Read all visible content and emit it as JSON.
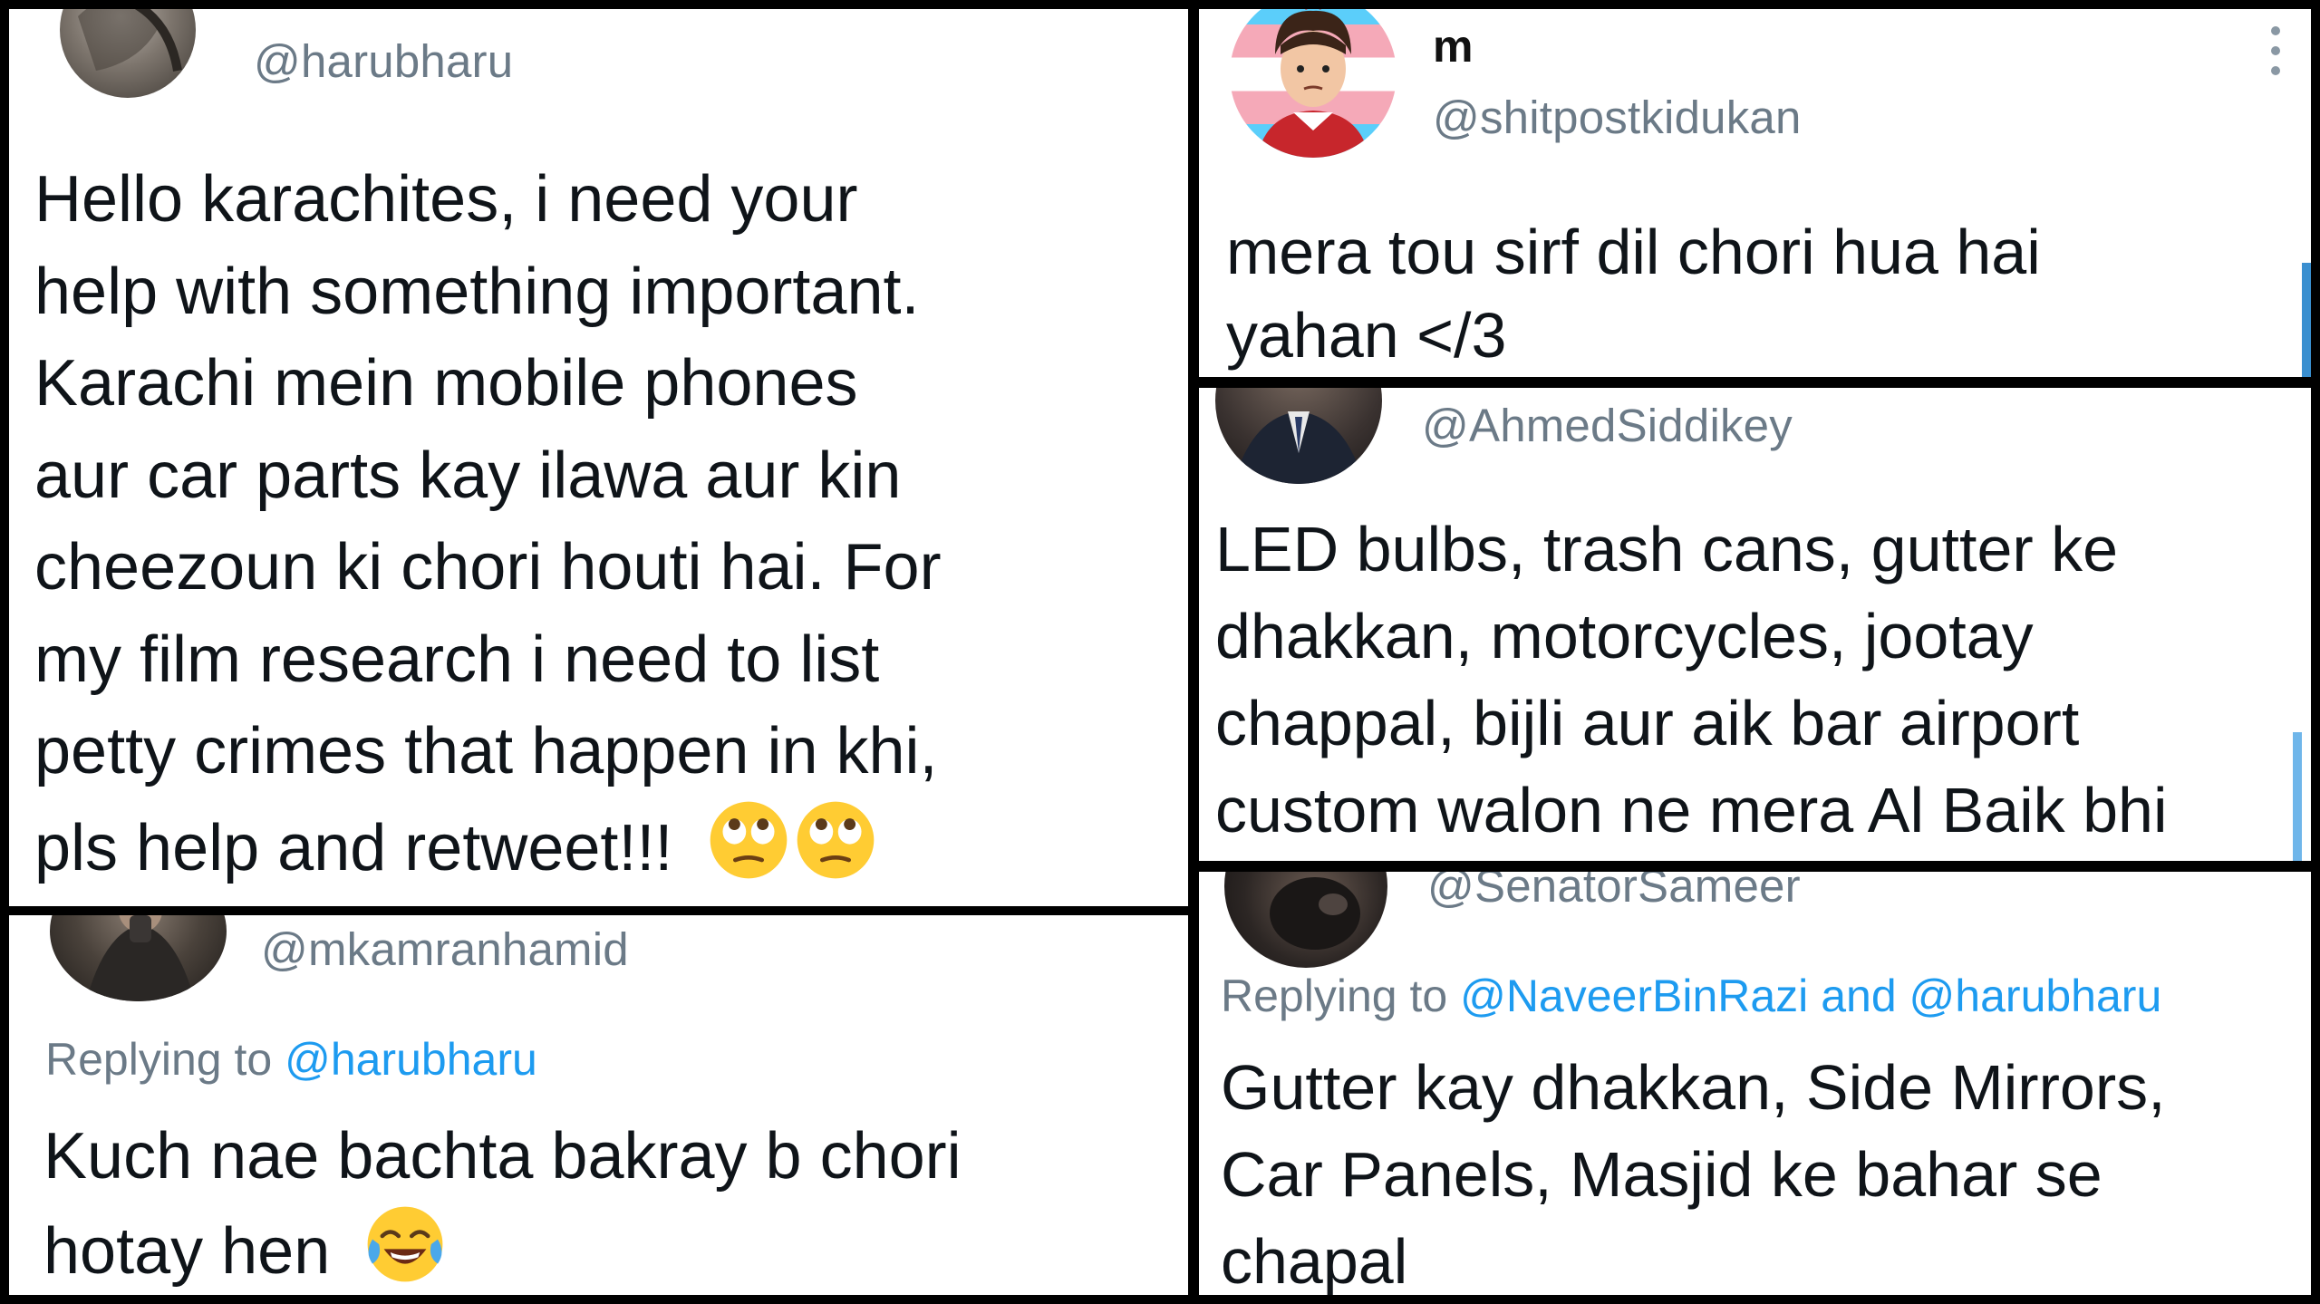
{
  "tweets": {
    "t1": {
      "handle": "@harubharu",
      "lines": [
        "Hello karachites, i need your",
        "help with something important.",
        "Karachi mein mobile phones",
        "aur car parts kay ilawa aur kin",
        "cheezoun ki chori houti hai. For",
        "my film research i need to list",
        "petty crimes that happen in khi,",
        "pls help and retweet!!!"
      ],
      "emoji_trailing": "face-with-rolling-eyes-icon x2"
    },
    "t2": {
      "handle": "@mkamranhamid",
      "reply_prefix": "Replying to",
      "reply_mention": "@harubharu",
      "lines": [
        "Kuch nae bachta bakray b chori",
        "hotay hen"
      ],
      "emoji_trailing": "face-with-tears-of-joy-icon"
    },
    "t3": {
      "name": "m",
      "handle": "@shitpostkidukan",
      "more_icon": "vertical-ellipsis-icon",
      "lines": [
        "mera tou sirf dil chori hua hai",
        "yahan </3"
      ]
    },
    "t4": {
      "handle": "@AhmedSiddikey",
      "lines": [
        "LED bulbs, trash cans, gutter ke",
        "dhakkan, motorcycles, jootay",
        "chappal, bijli aur aik bar airport",
        "custom walon ne mera Al Baik bhi"
      ]
    },
    "t5": {
      "handle": "@SenatorSameer",
      "reply_prefix": "Replying to",
      "reply_mention_1": "@NaveerBinRazi",
      "reply_and": "and",
      "reply_mention_2": "@harubharu",
      "lines": [
        "Gutter kay dhakkan, Side Mirrors,",
        "Car Panels, Masjid ke bahar se",
        "chapal"
      ]
    }
  },
  "colors": {
    "border": "#000000",
    "panel_bg": "#ffffff",
    "text": "#0f1419",
    "secondary": "#6b7a87",
    "mention": "#1d9bf0"
  }
}
